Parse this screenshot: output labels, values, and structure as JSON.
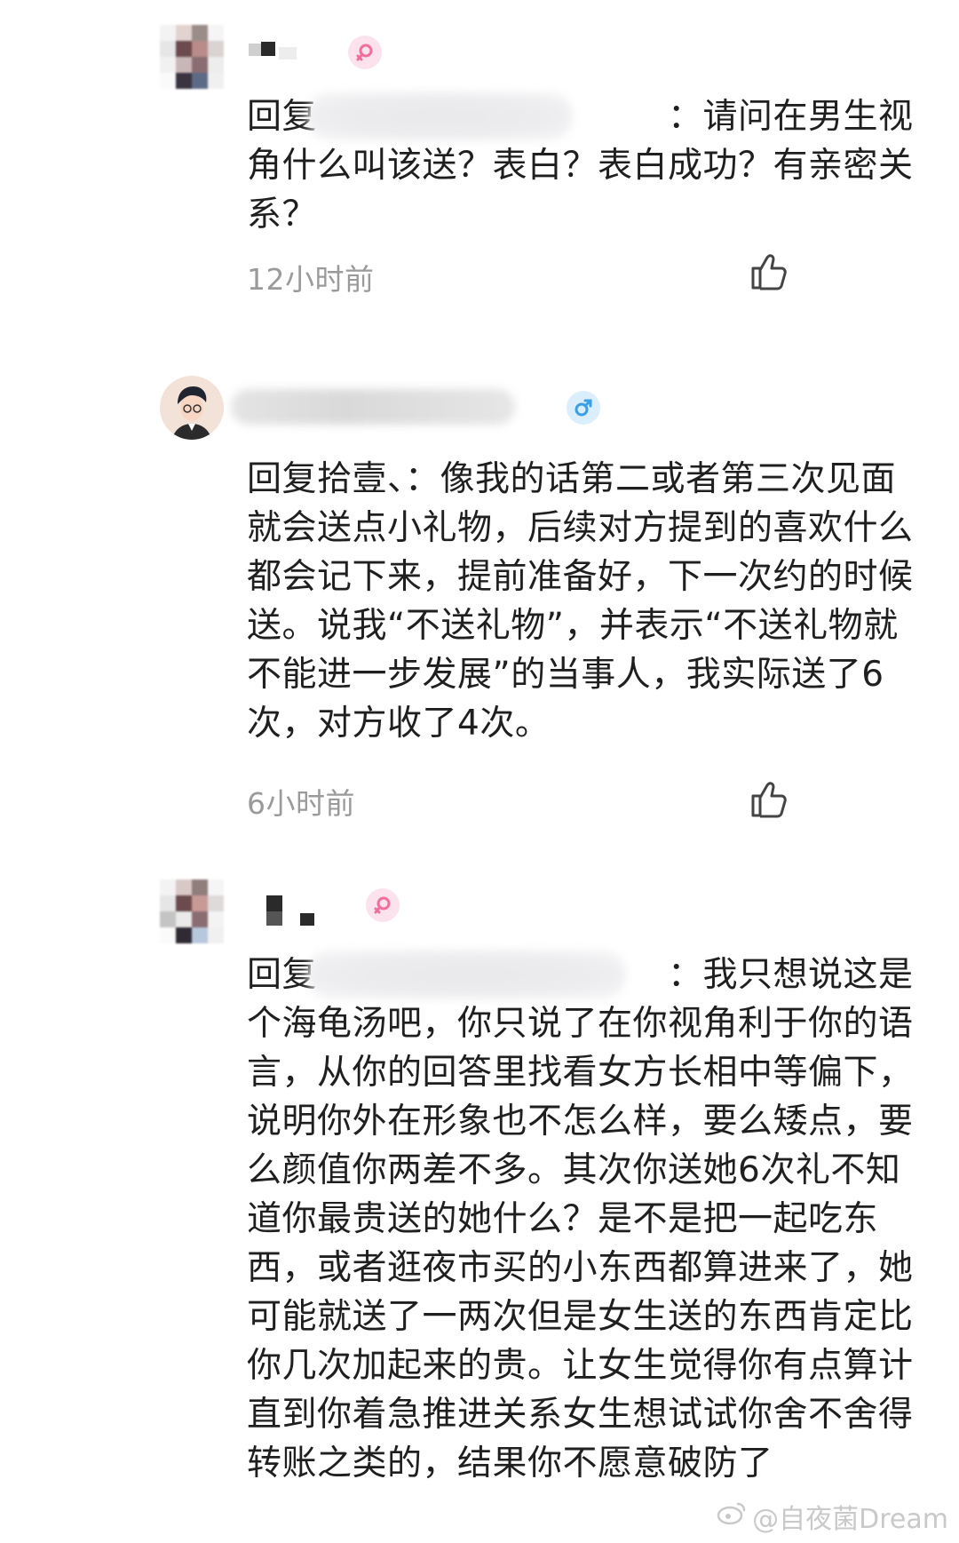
{
  "comments": [
    {
      "text": "回复　　　　　　　　　　：请问在男生视角什么叫该送？表白？表白成功？有亲密关系？",
      "time": "12小时前",
      "gender": "female",
      "gender_icon": "female-symbol-icon"
    },
    {
      "text": "回复拾壹、：像我的话第二或者第三次见面就会送点小礼物，后续对方提到的喜欢什么都会记下来，提前准备好，下一次约的时候送。说我“不送礼物”，并表示“不送礼物就不能进一步发展”的当事人，我实际送了6次，对方收了4次。",
      "time": "6小时前",
      "gender": "male",
      "gender_icon": "male-symbol-icon"
    },
    {
      "text": "回复　　　　　　　　　　：我只想说这是个海龟汤吧，你只说了在你视角利于你的语言，从你的回答里找看女方长相中等偏下，说明你外在形象也不怎么样，要么矮点，要么颜值你两差不多。其次你送她6次礼不知道你最贵送的她什么？是不是把一起吃东西，或者逛夜市买的小东西都算进来了，她可能就送了一两次但是女生送的东西肯定比你几次加起来的贵。让女生觉得你有点算计直到你着急推进关系女生想试试你舍不舍得转账之类的，结果你不愿意破防了",
      "gender": "female",
      "gender_icon": "female-symbol-icon"
    }
  ],
  "like_icon": "thumbs-up-icon",
  "watermark": {
    "icon": "weibo-logo-icon",
    "text": "@自夜菌Dream"
  },
  "colors": {
    "female": "#f06f9c",
    "male": "#3b9fe6",
    "time": "#9a9a9a"
  }
}
